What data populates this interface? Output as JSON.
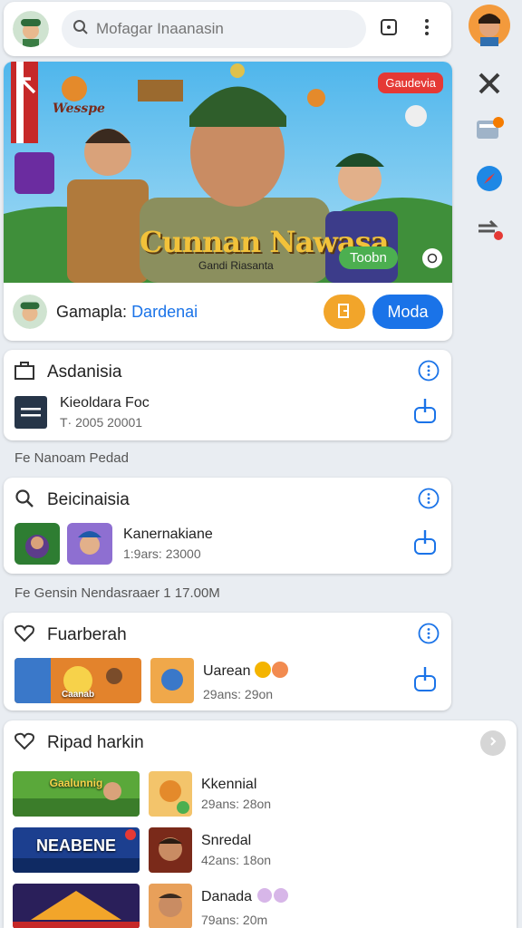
{
  "search": {
    "placeholder": "Mofagar Inaanasin"
  },
  "hero": {
    "badge": "Gaudevia",
    "corner_text": "Wesspe",
    "title": "Cunnan Nawasa",
    "subtitle": "Gandi Riasanta",
    "pill": "Toobn",
    "footer_label": "Gamapla:",
    "footer_link": "Dardenai",
    "primary_button": "Moda"
  },
  "card1": {
    "title": "Asdanisia",
    "entry_title": "Kieoldara Foc",
    "entry_sub": "T· 2005 20001"
  },
  "section1": "Fe Nanoam Pedad",
  "card2": {
    "title": "Beicinaisia",
    "entry_title": "Kanernakiane",
    "entry_sub": "1:9ars: 23000"
  },
  "section2": "Fe Gensin Nendasraaer 1 17.00M",
  "card3": {
    "title": "Fuarberah",
    "entry_title": "Uarean",
    "entry_sub": "29ans: 29on",
    "thumb_caption": "Caanab"
  },
  "card4": {
    "title": "Ripad harkin",
    "items": [
      {
        "title": "Kkennial",
        "sub": "29ans: 28on",
        "caption": "Gaalunnig"
      },
      {
        "title": "Snredal",
        "sub": "42ans: 18on",
        "caption": "NEABENE"
      },
      {
        "title": "Danada",
        "sub": "79ans: 20m",
        "caption": ""
      }
    ]
  },
  "colors": {
    "accent": "#1a73e8",
    "orange": "#f2a52a",
    "badge_red": "#e53935",
    "pill_green": "#4caf50"
  }
}
